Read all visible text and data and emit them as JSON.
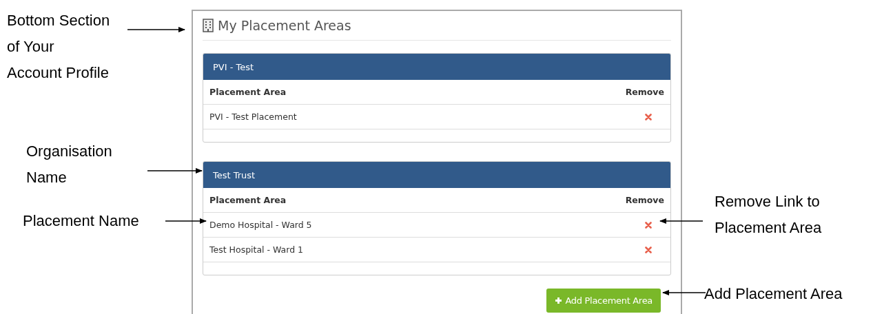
{
  "panel": {
    "title": "My Placement Areas",
    "organisations": [
      {
        "name": "PVI - Test",
        "columns": [
          "Placement Area",
          "Remove"
        ],
        "rows": [
          {
            "placement": "PVI - Test Placement"
          }
        ]
      },
      {
        "name": "Test Trust",
        "columns": [
          "Placement Area",
          "Remove"
        ],
        "rows": [
          {
            "placement": "Demo Hospital - Ward 5"
          },
          {
            "placement": "Test Hospital - Ward 1"
          }
        ]
      }
    ],
    "add_button": "Add Placement Area"
  },
  "annotations": [
    {
      "lines": [
        "Bottom Section",
        "of Your",
        "Account Profile"
      ]
    },
    {
      "lines": [
        "Organisation",
        "Name"
      ]
    },
    {
      "lines": [
        "Placement Name"
      ]
    },
    {
      "lines": [
        "Remove Link to",
        "Placement Area"
      ]
    },
    {
      "lines": [
        "Add Placement Area"
      ]
    }
  ]
}
